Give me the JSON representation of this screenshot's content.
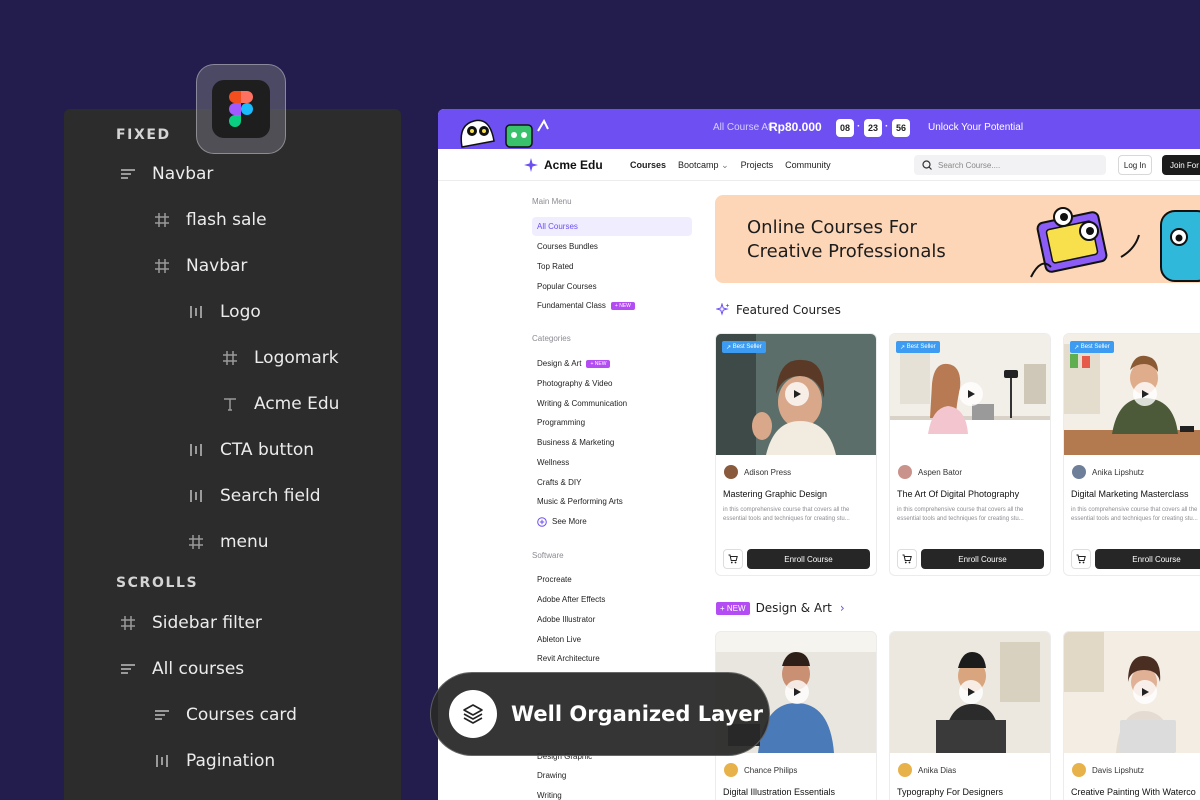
{
  "layers_panel": {
    "sections": [
      "FIXED",
      "SCROLLS"
    ],
    "fixed": [
      {
        "label": "Navbar",
        "icon": "auto-layout-icon"
      },
      {
        "label": "flash sale",
        "icon": "frame-icon"
      },
      {
        "label": "Navbar",
        "icon": "frame-icon"
      },
      {
        "label": "Logo",
        "icon": "auto-layout-horizontal-icon"
      },
      {
        "label": "Logomark",
        "icon": "frame-icon"
      },
      {
        "label": "Acme Edu",
        "icon": "text-icon"
      },
      {
        "label": "CTA button",
        "icon": "auto-layout-horizontal-icon"
      },
      {
        "label": "Search field",
        "icon": "auto-layout-horizontal-icon"
      },
      {
        "label": "menu",
        "icon": "frame-icon"
      }
    ],
    "scrolls": [
      {
        "label": "Sidebar filter",
        "icon": "frame-icon"
      },
      {
        "label": "All courses",
        "icon": "auto-layout-icon"
      },
      {
        "label": "Courses card",
        "icon": "auto-layout-icon"
      },
      {
        "label": "Pagination",
        "icon": "auto-layout-horizontal-icon"
      }
    ]
  },
  "flash_sale": {
    "text": "All Course At",
    "price": "Rp80.000",
    "hours": "08",
    "minutes": "23",
    "seconds": "56",
    "unlock": "Unlock Your Potential"
  },
  "navbar": {
    "brand": "Acme Edu",
    "links": [
      "Courses",
      "Bootcamp",
      "Projects",
      "Community"
    ],
    "search_placeholder": "Search Course....",
    "login": "Log In",
    "join": "Join For"
  },
  "sidebar": {
    "main_menu_title": "Main Menu",
    "main_menu": [
      "All Courses",
      "Courses Bundles",
      "Top Rated",
      "Popular Courses",
      "Fundamental Class"
    ],
    "categories_title": "Categories",
    "categories": [
      "Design & Art",
      "Photography & Video",
      "Writing & Communication",
      "Programming",
      "Business & Marketing",
      "Wellness",
      "Crafts & DIY",
      "Music & Performing Arts"
    ],
    "see_more": "See More",
    "software_title": "Software",
    "software": [
      "Procreate",
      "Adobe After Effects",
      "Adobe Illustrator",
      "Ableton Live",
      "Revit Architecture"
    ],
    "bottom": [
      "Design Graphic",
      "Drawing",
      "Writing"
    ],
    "new_tag": "NEW"
  },
  "hero": {
    "line1": "Online Courses For",
    "line2": "Creative Professionals"
  },
  "featured": {
    "title": "Featured Courses",
    "badge": "Best Seller",
    "enroll": "Enroll Course",
    "desc": "in this comprehensive course that covers all the essential tools and techniques for creating stu...",
    "cards": [
      {
        "author": "Adison Press",
        "title": "Mastering Graphic Design"
      },
      {
        "author": "Aspen Bator",
        "title": "The Art Of Digital Photography"
      },
      {
        "author": "Anika Lipshutz",
        "title": "Digital Marketing Masterclass"
      }
    ]
  },
  "design_art": {
    "tag": "+ NEW",
    "title": "Design & Art",
    "cards": [
      {
        "author": "Chance Philips",
        "title": "Digital Illustration Essentials"
      },
      {
        "author": "Anika Dias",
        "title": "Typography For Designers"
      },
      {
        "author": "Davis Lipshutz",
        "title": "Creative Painting With Waterco"
      }
    ]
  },
  "overlay": {
    "label": "Well Organized Layer"
  },
  "colors": {
    "background": "#221d4d",
    "panel": "#2c2c2c",
    "accent": "#6d4ff2",
    "hero": "#fdd6b7"
  }
}
